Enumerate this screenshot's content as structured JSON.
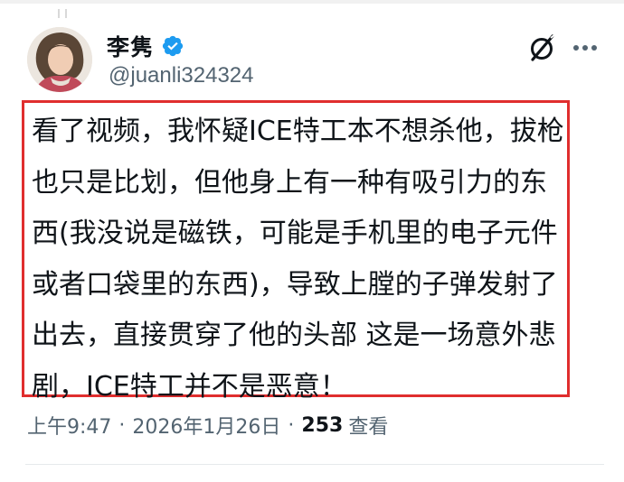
{
  "user": {
    "display_name": "李隽",
    "handle": "@juanli324324",
    "verified": true,
    "verified_color": "#1d9bf0"
  },
  "tweet": {
    "text": "看了视频，我怀疑ICE特工本不想杀他，拔枪也只是比划，但他身上有一种有吸引力的东西(我没说是磁铁，可能是手机里的电子元件或者口袋里的东西)，导致上膛的子弹发射了出去，直接贯穿了他的头部     这是一场意外悲剧，ICE特工并不是恶意！",
    "highlight_border_color": "#e02e2e"
  },
  "meta": {
    "time": "上午9:47",
    "date": "2026年1月26日",
    "separator": "·",
    "views_count": "253",
    "views_label": "查看"
  },
  "icons": {
    "grok": "grok-icon",
    "more": "more-options-icon",
    "verified": "verified-badge-icon"
  }
}
